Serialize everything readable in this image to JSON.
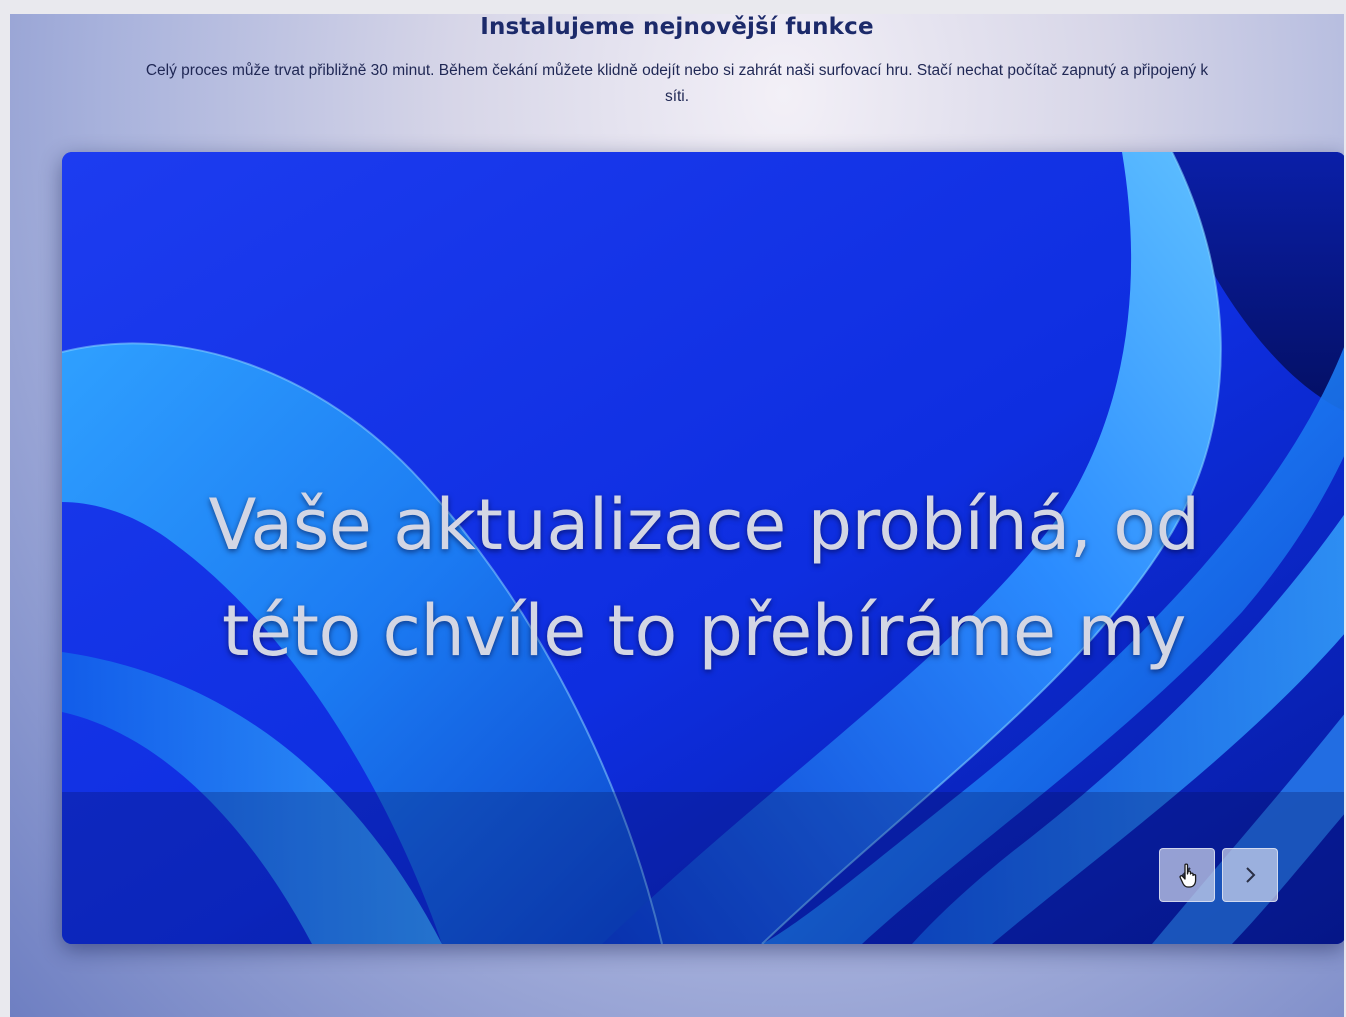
{
  "header": {
    "title": "Instalujeme nejnovější funkce",
    "subtitle": "Celý proces může trvat přibližně 30 minut. Během čekání můžete klidně odejít nebo si zahrát naši surfovací hru. Stačí nechat počítač zapnutý a připojený k síti."
  },
  "slide": {
    "message_line1": "Vaše aktualizace probíhá, od",
    "message_line2": "této chvíle to přebíráme my"
  },
  "controls": {
    "prev_icon": "chevron-left-icon",
    "next_icon": "chevron-right-icon",
    "cursor_icon": "hand-pointer-icon"
  },
  "colors": {
    "title": "#1c2a6a",
    "subtitle": "#1f2754",
    "slide_background": "#0b2fd0",
    "slide_text": "#d3d6e4",
    "button_background": "#cdd4ec"
  }
}
